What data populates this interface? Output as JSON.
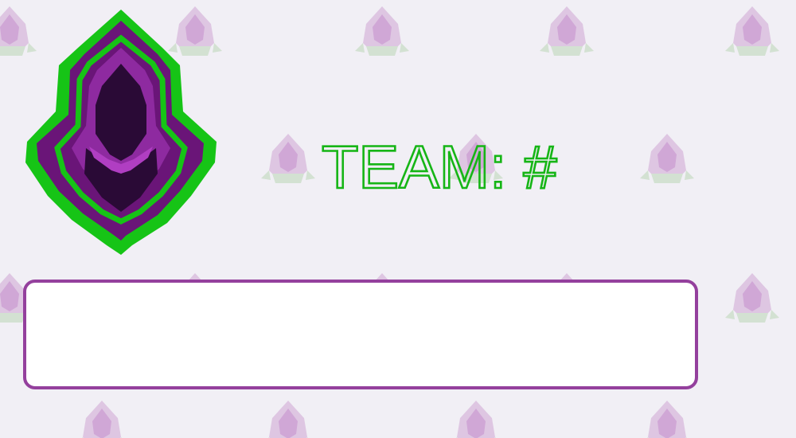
{
  "team_label": "TEAM: #",
  "name_box": {
    "value": ""
  },
  "colors": {
    "background": "#f1eff5",
    "accent_green": "#16c416",
    "accent_purple": "#7a1f8c",
    "box_border": "#94409d"
  },
  "icons": {
    "emblem": "hooded-figure-shield-icon",
    "background_tile": "faded-team-logo-icon"
  }
}
